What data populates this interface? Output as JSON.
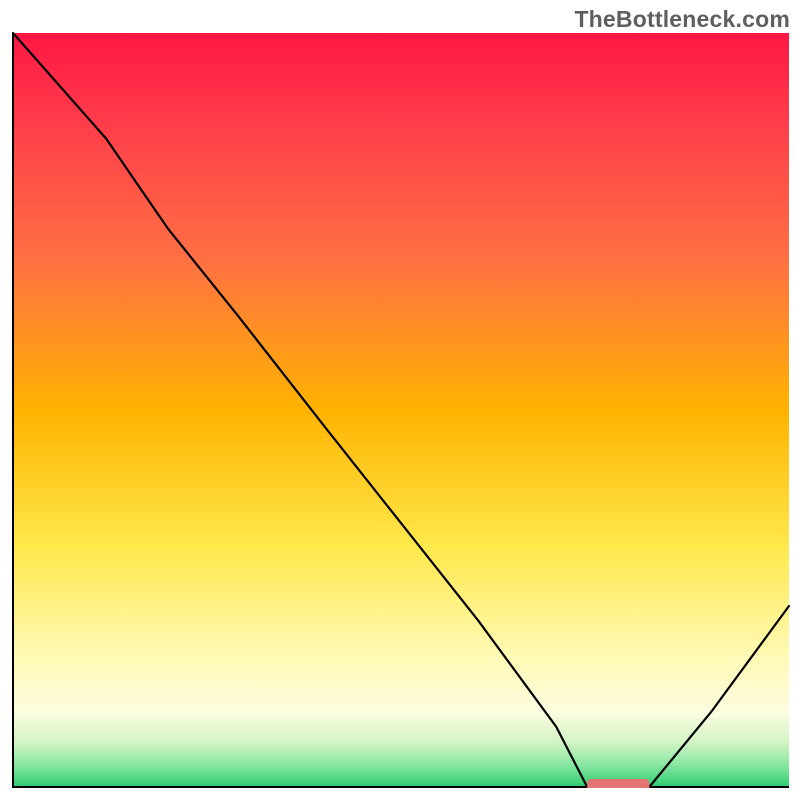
{
  "watermark": "TheBottleneck.com",
  "chart_data": {
    "type": "line",
    "title": "",
    "xlabel": "",
    "ylabel": "",
    "xlim": [
      0,
      100
    ],
    "ylim": [
      0,
      100
    ],
    "flat_segment_x": [
      74,
      82
    ],
    "flat_y": 0,
    "series": [
      {
        "name": "bottleneck-curve",
        "x": [
          0,
          12,
          20,
          29,
          40,
          50,
          60,
          70,
          74,
          78,
          82,
          90,
          100
        ],
        "y": [
          100,
          86,
          74,
          62.5,
          48,
          35,
          22,
          8,
          0,
          0,
          0,
          10,
          24
        ]
      }
    ],
    "marker": {
      "name": "current-config",
      "x_start": 74,
      "x_end": 82,
      "y": 0,
      "color": "#e57373"
    },
    "gradient_stops": [
      {
        "offset": 0,
        "color": "#ff1744"
      },
      {
        "offset": 0.12,
        "color": "#ff3d4a"
      },
      {
        "offset": 0.3,
        "color": "#ff7043"
      },
      {
        "offset": 0.5,
        "color": "#ffb300"
      },
      {
        "offset": 0.68,
        "color": "#ffe84a"
      },
      {
        "offset": 0.82,
        "color": "#fff9b0"
      },
      {
        "offset": 0.9,
        "color": "#fdfde0"
      },
      {
        "offset": 0.94,
        "color": "#d4f5c6"
      },
      {
        "offset": 0.97,
        "color": "#8ae6a2"
      },
      {
        "offset": 1.0,
        "color": "#2ecc71"
      }
    ]
  }
}
